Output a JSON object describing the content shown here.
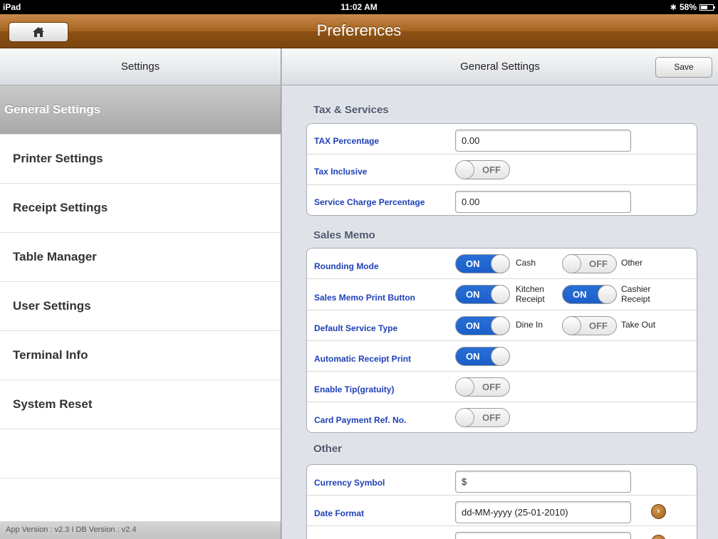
{
  "status": {
    "device": "iPad",
    "time": "11:02 AM",
    "battery": "58%",
    "battery_level": 0.58
  },
  "titlebar": {
    "title": "Preferences"
  },
  "left": {
    "header": "Settings",
    "items": [
      {
        "label": "General Settings"
      },
      {
        "label": "Printer Settings"
      },
      {
        "label": "Receipt Settings"
      },
      {
        "label": "Table Manager"
      },
      {
        "label": "User Settings"
      },
      {
        "label": "Terminal Info"
      },
      {
        "label": "System Reset"
      }
    ],
    "footer": "App Version : v2.3  I  DB Version : v2.4"
  },
  "right": {
    "header": "General Settings",
    "save_label": "Save",
    "tax": {
      "title": "Tax & Services",
      "tax_percentage": {
        "label": "TAX Percentage",
        "value": "0.00"
      },
      "tax_inclusive": {
        "label": "Tax Inclusive",
        "state": "OFF"
      },
      "service_charge": {
        "label": "Service Charge Percentage",
        "value": "0.00"
      }
    },
    "memo": {
      "title": "Sales Memo",
      "rounding": {
        "label": "Rounding Mode",
        "opt1_state": "ON",
        "opt1_label": "Cash",
        "opt2_state": "OFF",
        "opt2_label": "Other"
      },
      "print_button": {
        "label": "Sales Memo Print Button",
        "opt1_state": "ON",
        "opt1_label": "Kitchen\nReceipt",
        "opt2_state": "ON",
        "opt2_label": "Cashier\nReceipt"
      },
      "service_type": {
        "label": "Default Service Type",
        "opt1_state": "ON",
        "opt1_label": "Dine In",
        "opt2_state": "OFF",
        "opt2_label": "Take Out"
      },
      "auto_print": {
        "label": "Automatic Receipt Print",
        "state": "ON"
      },
      "tip": {
        "label": "Enable Tip(gratuity)",
        "state": "OFF"
      },
      "card_ref": {
        "label": "Card Payment Ref. No.",
        "state": "OFF"
      }
    },
    "other": {
      "title": "Other",
      "currency": {
        "label": "Currency Symbol",
        "value": "$"
      },
      "date_format": {
        "label": "Date Format",
        "value": "dd-MM-yyyy (25-01-2010)"
      }
    }
  }
}
